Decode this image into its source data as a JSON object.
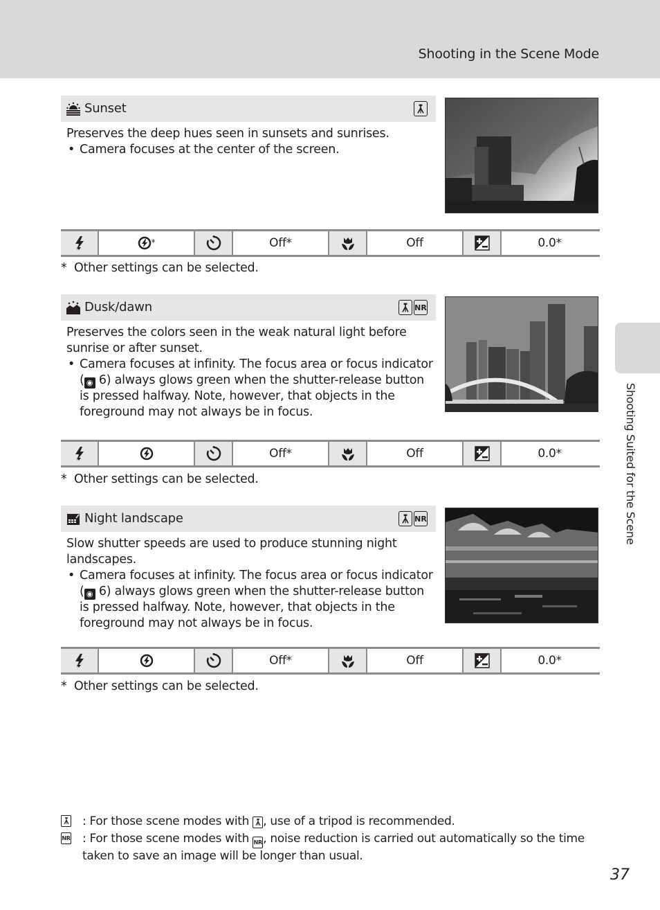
{
  "header": {
    "title": "Shooting in the Scene Mode"
  },
  "side_tab": {
    "label": "Shooting Suited for the Scene"
  },
  "sections": [
    {
      "icon": "sunset-icon",
      "title": "Sunset",
      "badges": [
        "tripod-icon"
      ],
      "description": "Preserves the deep hues seen in sunsets and sunrises.",
      "bullets": [
        {
          "pre": "Camera focuses at the center of the screen.",
          "ref": "",
          "post": ""
        }
      ],
      "photo": "sunset-photo",
      "settings": {
        "flash": "flash-off-icon",
        "flash_asterisk": "*",
        "self_timer": "Off*",
        "macro": "Off",
        "exposure": "0.0*"
      },
      "note": "Other settings can be selected."
    },
    {
      "icon": "dusk-dawn-icon",
      "title": "Dusk/dawn",
      "badges": [
        "tripod-icon",
        "noise-reduction-icon"
      ],
      "description": "Preserves the colors seen in the weak natural light before sunrise or after sunset.",
      "bullets": [
        {
          "pre": "Camera focuses at infinity. The focus area or focus indicator (",
          "ref": "6",
          "post": ") always glows green when the shutter-release button is pressed halfway. Note, however, that objects in the foreground may not always be in focus."
        }
      ],
      "photo": "dusk-dawn-photo",
      "settings": {
        "flash": "flash-off-icon",
        "flash_asterisk": "",
        "self_timer": "Off*",
        "macro": "Off",
        "exposure": "0.0*"
      },
      "note": "Other settings can be selected."
    },
    {
      "icon": "night-landscape-icon",
      "title": "Night landscape",
      "badges": [
        "tripod-icon",
        "noise-reduction-icon"
      ],
      "description": "Slow shutter speeds are used to produce stunning night landscapes.",
      "bullets": [
        {
          "pre": "Camera focuses at infinity. The focus area or focus indicator (",
          "ref": "6",
          "post": ") always glows green when the shutter-release button is pressed halfway. Note, however, that objects in the foreground may not always be in focus."
        }
      ],
      "photo": "night-landscape-photo",
      "settings": {
        "flash": "flash-off-icon",
        "flash_asterisk": "",
        "self_timer": "Off*",
        "macro": "Off",
        "exposure": "0.0*"
      },
      "note": "Other settings can be selected."
    }
  ],
  "note_asterisk": "*",
  "badge_text": {
    "nr": "NR"
  },
  "footnotes": [
    {
      "key": "tripod-icon",
      "pre": ": For those scene modes with ",
      "post": ", use of a tripod is recommended."
    },
    {
      "key": "noise-reduction-icon",
      "pre": ": For those scene modes with ",
      "post": ", noise reduction is carried out automatically so the time taken to save an image will be longer than usual."
    }
  ],
  "page_number": "37"
}
